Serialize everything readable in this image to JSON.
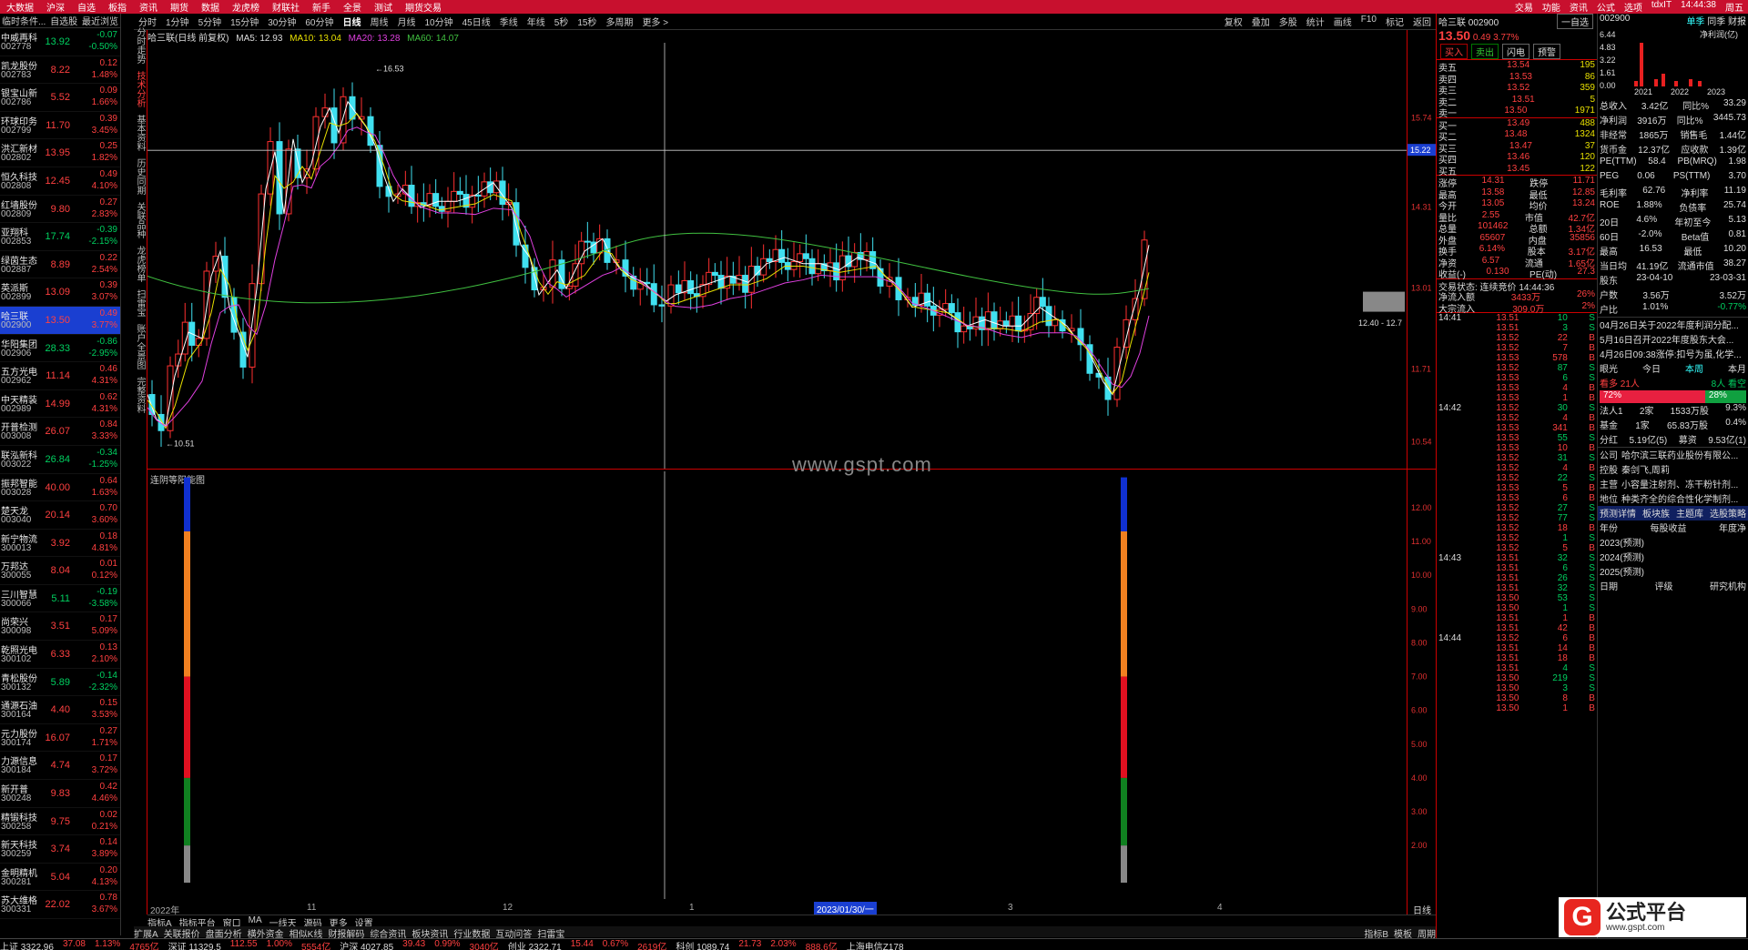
{
  "menubar": {
    "items": [
      "大数据",
      "沪深",
      "自选",
      "板指",
      "资讯",
      "期货",
      "数据",
      "龙虎榜",
      "财联社",
      "新手",
      "全景",
      "测试",
      "期货交易"
    ],
    "right": [
      "交易",
      "功能",
      "资讯",
      "公式",
      "选项",
      "tdxIT",
      "14:44:38",
      "周五"
    ]
  },
  "left_header": {
    "a": "临时条件...",
    "b": "自选股",
    "c": "最近浏览"
  },
  "stocks": [
    {
      "name": "中威再科",
      "code": "002778",
      "price": "13.92",
      "chg": "-0.07",
      "pct": "-0.50%",
      "d": "dn"
    },
    {
      "name": "凯龙股份",
      "code": "002783",
      "price": "8.22",
      "chg": "0.12",
      "pct": "1.48%",
      "d": "up"
    },
    {
      "name": "银宝山新",
      "code": "002786",
      "price": "5.52",
      "chg": "0.09",
      "pct": "1.66%",
      "d": "up"
    },
    {
      "name": "环球印务",
      "code": "002799",
      "price": "11.70",
      "chg": "0.39",
      "pct": "3.45%",
      "d": "up"
    },
    {
      "name": "洪汇新材",
      "code": "002802",
      "price": "13.95",
      "chg": "0.25",
      "pct": "1.82%",
      "d": "up"
    },
    {
      "name": "恒久科技",
      "code": "002808",
      "price": "12.45",
      "chg": "0.49",
      "pct": "4.10%",
      "d": "up"
    },
    {
      "name": "红墙股份",
      "code": "002809",
      "price": "9.80",
      "chg": "0.27",
      "pct": "2.83%",
      "d": "up"
    },
    {
      "name": "亚翔科",
      "code": "002853",
      "price": "17.74",
      "chg": "-0.39",
      "pct": "-2.15%",
      "d": "dn"
    },
    {
      "name": "绿茵生态",
      "code": "002887",
      "price": "8.89",
      "chg": "0.22",
      "pct": "2.54%",
      "d": "up"
    },
    {
      "name": "英派斯",
      "code": "002899",
      "price": "13.09",
      "chg": "0.39",
      "pct": "3.07%",
      "d": "up"
    },
    {
      "name": "哈三联",
      "code": "002900",
      "price": "13.50",
      "chg": "0.49",
      "pct": "3.77%",
      "d": "up",
      "sel": true
    },
    {
      "name": "华阳集团",
      "code": "002906",
      "price": "28.33",
      "chg": "-0.86",
      "pct": "-2.95%",
      "d": "dn"
    },
    {
      "name": "五方光电",
      "code": "002962",
      "price": "11.14",
      "chg": "0.46",
      "pct": "4.31%",
      "d": "up"
    },
    {
      "name": "中天精装",
      "code": "002989",
      "price": "14.99",
      "chg": "0.62",
      "pct": "4.31%",
      "d": "up"
    },
    {
      "name": "开普检测",
      "code": "003008",
      "price": "26.07",
      "chg": "0.84",
      "pct": "3.33%",
      "d": "up"
    },
    {
      "name": "联泓新科",
      "code": "003022",
      "price": "26.84",
      "chg": "-0.34",
      "pct": "-1.25%",
      "d": "dn"
    },
    {
      "name": "振邦智能",
      "code": "003028",
      "price": "40.00",
      "chg": "0.64",
      "pct": "1.63%",
      "d": "up"
    },
    {
      "name": "楚天龙",
      "code": "003040",
      "price": "20.14",
      "chg": "0.70",
      "pct": "3.60%",
      "d": "up"
    },
    {
      "name": "新宁物流",
      "code": "300013",
      "price": "3.92",
      "chg": "0.18",
      "pct": "4.81%",
      "d": "up"
    },
    {
      "name": "万邦达",
      "code": "300055",
      "price": "8.04",
      "chg": "0.01",
      "pct": "0.12%",
      "d": "up"
    },
    {
      "name": "三川智慧",
      "code": "300066",
      "price": "5.11",
      "chg": "-0.19",
      "pct": "-3.58%",
      "d": "dn"
    },
    {
      "name": "尚荣兴",
      "code": "300098",
      "price": "3.51",
      "chg": "0.17",
      "pct": "5.09%",
      "d": "up"
    },
    {
      "name": "乾照光电",
      "code": "300102",
      "price": "6.33",
      "chg": "0.13",
      "pct": "2.10%",
      "d": "up"
    },
    {
      "name": "青松股份",
      "code": "300132",
      "price": "5.89",
      "chg": "-0.14",
      "pct": "-2.32%",
      "d": "dn"
    },
    {
      "name": "通源石油",
      "code": "300164",
      "price": "4.40",
      "chg": "0.15",
      "pct": "3.53%",
      "d": "up"
    },
    {
      "name": "元力股份",
      "code": "300174",
      "price": "16.07",
      "chg": "0.27",
      "pct": "1.71%",
      "d": "up"
    },
    {
      "name": "力源信息",
      "code": "300184",
      "price": "4.74",
      "chg": "0.17",
      "pct": "3.72%",
      "d": "up"
    },
    {
      "name": "新开普",
      "code": "300248",
      "price": "9.83",
      "chg": "0.42",
      "pct": "4.46%",
      "d": "up"
    },
    {
      "name": "精锻科技",
      "code": "300258",
      "price": "9.75",
      "chg": "0.02",
      "pct": "0.21%",
      "d": "up"
    },
    {
      "name": "新天科技",
      "code": "300259",
      "price": "3.74",
      "chg": "0.14",
      "pct": "3.89%",
      "d": "up"
    },
    {
      "name": "金明精机",
      "code": "300281",
      "price": "5.04",
      "chg": "0.20",
      "pct": "4.13%",
      "d": "up"
    },
    {
      "name": "苏大维格",
      "code": "300331",
      "price": "22.02",
      "chg": "0.78",
      "pct": "3.67%",
      "d": "up"
    }
  ],
  "vtabs": [
    "分时走势",
    "技术分析",
    "基本资料",
    "历史同期",
    "关联品种",
    "龙虎榜单",
    "扫雷宝",
    "账户全景图",
    "完整资料"
  ],
  "toptabs": [
    "分时",
    "1分钟",
    "5分钟",
    "15分钟",
    "30分钟",
    "60分钟",
    "日线",
    "周线",
    "月线",
    "10分钟",
    "45日线",
    "季线",
    "年线",
    "5秒",
    "15秒",
    "多周期",
    "更多 >"
  ],
  "toptabs_right": [
    "复权",
    "叠加",
    "多股",
    "统计",
    "画线",
    "F10",
    "标记",
    "返回"
  ],
  "chart_info": {
    "name": "哈三联(日线 前复权)",
    "ma5": "MA5: 12.93",
    "ma10": "MA10: 13.04",
    "ma20": "MA20: 13.28",
    "ma60": "MA60: 14.07"
  },
  "main_axis": [
    "15.74",
    "15.22",
    "14.31",
    "13.01",
    "11.71",
    "10.54"
  ],
  "high_label": "16.53",
  "low_label": "10.51",
  "crosshair_value": "15.22",
  "range_label": "12.40 - 12.7",
  "sub_title": "连阴等阳能图",
  "sub_axis": [
    "12.00",
    "11.00",
    "10.00",
    "9.00",
    "8.00",
    "7.00",
    "6.00",
    "5.00",
    "4.00",
    "3.00",
    "2.00"
  ],
  "x_dates": [
    "2022年",
    "11",
    "12",
    "1",
    "2023/01/30/一",
    "3",
    "4",
    "日线"
  ],
  "bottab1": [
    "指标A",
    "指标平台",
    "窗口",
    "MA",
    "一线天",
    "源码",
    "更多",
    "设置"
  ],
  "bottab2": [
    "扩展A",
    "关联报价",
    "盘面分析",
    "横外资金",
    "相似K线",
    "财报解码",
    "综合资讯",
    "板块资讯",
    "行业数据",
    "互动问答",
    "扫雷宝"
  ],
  "bottab2_right": [
    "指标B",
    "模板",
    "周期"
  ],
  "watermark": "www.gspt.com",
  "quote": {
    "name": "哈三联",
    "code": "002900",
    "tag": "一自选",
    "price": "13.50",
    "chg": "0.49",
    "pct": "3.77%",
    "btns": [
      "买入",
      "卖出",
      "闪电",
      "预警"
    ],
    "asks": [
      [
        "卖五",
        "13.54",
        "195"
      ],
      [
        "卖四",
        "13.53",
        "86"
      ],
      [
        "卖三",
        "13.52",
        "359"
      ],
      [
        "卖二",
        "13.51",
        "5"
      ],
      [
        "卖一",
        "13.50",
        "1971"
      ]
    ],
    "bids": [
      [
        "买一",
        "13.49",
        "488"
      ],
      [
        "买二",
        "13.48",
        "1324"
      ],
      [
        "买三",
        "13.47",
        "37"
      ],
      [
        "买四",
        "13.46",
        "120"
      ],
      [
        "买五",
        "13.45",
        "122"
      ]
    ],
    "stats": [
      [
        "涨停",
        "14.31",
        "跌停",
        "11.71"
      ],
      [
        "最高",
        "13.58",
        "最低",
        "12.85"
      ],
      [
        "今开",
        "13.05",
        "均价",
        "13.24"
      ],
      [
        "量比",
        "2.55",
        "市值",
        "42.7亿"
      ],
      [
        "总量",
        "101462",
        "总额",
        "1.34亿"
      ],
      [
        "外盘",
        "65607",
        "内盘",
        "35856"
      ],
      [
        "换手",
        "6.14%",
        "股本",
        "3.17亿"
      ],
      [
        "净资",
        "6.57",
        "流通",
        "1.65亿"
      ],
      [
        "收益(-)",
        "0.130",
        "PE(动)",
        "27.3"
      ]
    ],
    "trade_status": "交易状态: 连续竞价 14:44:36",
    "inflow": [
      [
        "净流入额",
        "3433万",
        "26%"
      ],
      [
        "大宗流入",
        "309.0万",
        "2%"
      ]
    ],
    "time_marks": [
      "14:41",
      "14:42",
      "14:43",
      "14:44"
    ],
    "ticks": [
      [
        "13.51",
        "10",
        "S"
      ],
      [
        "13.51",
        "3",
        "S"
      ],
      [
        "13.52",
        "22",
        "B"
      ],
      [
        "13.52",
        "7",
        "B"
      ],
      [
        "13.53",
        "578",
        "B"
      ],
      [
        "13.52",
        "87",
        "S"
      ],
      [
        "13.53",
        "6",
        "S"
      ],
      [
        "13.53",
        "4",
        "B"
      ],
      [
        "13.53",
        "1",
        "B"
      ],
      [
        "13.52",
        "30",
        "S"
      ],
      [
        "13.52",
        "4",
        "B"
      ],
      [
        "13.53",
        "341",
        "B"
      ],
      [
        "13.53",
        "55",
        "S"
      ],
      [
        "13.53",
        "10",
        "B"
      ],
      [
        "13.52",
        "31",
        "S"
      ],
      [
        "13.52",
        "4",
        "B"
      ],
      [
        "13.52",
        "22",
        "S"
      ],
      [
        "13.53",
        "5",
        "B"
      ],
      [
        "13.53",
        "6",
        "B"
      ],
      [
        "13.52",
        "27",
        "S"
      ],
      [
        "13.52",
        "77",
        "S"
      ],
      [
        "13.52",
        "18",
        "B"
      ],
      [
        "13.52",
        "1",
        "S"
      ],
      [
        "13.52",
        "5",
        "B"
      ],
      [
        "13.51",
        "32",
        "S"
      ],
      [
        "13.51",
        "6",
        "S"
      ],
      [
        "13.51",
        "26",
        "S"
      ],
      [
        "13.51",
        "32",
        "S"
      ],
      [
        "13.50",
        "53",
        "S"
      ],
      [
        "13.50",
        "1",
        "S"
      ],
      [
        "13.51",
        "1",
        "B"
      ],
      [
        "13.51",
        "42",
        "B"
      ],
      [
        "13.52",
        "6",
        "B"
      ],
      [
        "13.51",
        "14",
        "B"
      ],
      [
        "13.51",
        "18",
        "B"
      ],
      [
        "13.51",
        "4",
        "S"
      ],
      [
        "13.50",
        "219",
        "S"
      ],
      [
        "13.50",
        "3",
        "S"
      ],
      [
        "13.50",
        "8",
        "B"
      ],
      [
        "13.50",
        "1",
        "B"
      ]
    ]
  },
  "fund": {
    "code": "002900",
    "tabs": [
      "单季",
      "同季",
      "财报",
      "净利润(亿)"
    ],
    "bars": [
      "6.44",
      "4.83",
      "3.22",
      "1.61",
      "0.00"
    ],
    "years": [
      "2021",
      "2022",
      "2023"
    ],
    "rows": [
      [
        "总收入",
        "3.42亿",
        "同比%",
        "33.29"
      ],
      [
        "净利润",
        "3916万",
        "同比%",
        "3445.73"
      ],
      [
        "非经常",
        "1865万",
        "销售毛",
        "1.44亿"
      ],
      [
        "货币金",
        "12.37亿",
        "应收款",
        "1.39亿"
      ],
      [
        "PE(TTM)",
        "58.4",
        "PB(MRQ)",
        "1.98"
      ],
      [
        "PEG",
        "0.06",
        "PS(TTM)",
        "3.70"
      ],
      [
        "毛利率",
        "62.76",
        "净利率",
        "11.19"
      ],
      [
        "ROE",
        "1.88%",
        "负债率",
        "25.74"
      ],
      [
        "20日",
        "4.6%",
        "年初至今",
        "5.13"
      ],
      [
        "60日",
        "-2.0%",
        "Beta值",
        "0.81"
      ],
      [
        "最高",
        "16.53",
        "最低",
        "10.20"
      ],
      [
        "当日均",
        "41.19亿",
        "流通市值",
        "38.27"
      ],
      [
        "股东",
        "23-04-10",
        "",
        "23-03-31"
      ],
      [
        "户数",
        "3.56万",
        "",
        "3.52万"
      ],
      [
        "户比",
        "1.01%",
        "",
        "-0.77%"
      ]
    ],
    "news": [
      "04月26日关于2022年度利润分配...",
      "5月16日召开2022年度股东大会...",
      "4月26日09:38涨停:扣号为虽,化学..."
    ],
    "vote": {
      "label": "眼光",
      "today": "今日",
      "week": "本周",
      "month": "本月",
      "bull": "看多 21人",
      "bear": "8人 看空",
      "p1": "72%",
      "p2": "28%"
    },
    "holders": [
      [
        "法人1",
        "2家",
        "1533万股",
        "9.3%"
      ],
      [
        "基金",
        "1家",
        "65.83万股",
        "0.4%"
      ],
      [
        "分红",
        "5.19亿(5)",
        "募资",
        "9.53亿(1)"
      ]
    ],
    "company": [
      [
        "公司",
        "哈尔滨三联药业股份有限公..."
      ],
      [
        "控股",
        "秦剑飞,周莉"
      ],
      [
        "主营",
        "小容量注射剂、冻干粉针剂..."
      ],
      [
        "地位",
        "种类齐全的综合性化学制剂..."
      ]
    ],
    "ftabs": [
      "预测详情",
      "板块族",
      "主题库",
      "选股策略"
    ],
    "forecast_head": [
      "年份",
      "每股收益",
      "年度净"
    ],
    "forecast": [
      "2023(预测)",
      "2024(预测)",
      "2025(预测)"
    ],
    "rating_head": [
      "日期",
      "评级",
      "研究机构"
    ]
  },
  "statusbar": [
    "上证 3322.96",
    "37.08",
    "1.13%",
    "4765亿",
    "深证 11329.5",
    "112.55",
    "1.00%",
    "5554亿",
    "沪深 4027.85",
    "39.43",
    "0.99%",
    "3040亿",
    "创业 2322.71",
    "15.44",
    "0.67%",
    "2619亿",
    "科创 1089.74",
    "21.73",
    "2.03%",
    "888.6亿",
    "上海电信Z178"
  ],
  "logo": {
    "mark": "G",
    "name": "公式平台",
    "url": "www.gspt.com"
  },
  "colors": {
    "up": "#ff4040",
    "down": "#00d060",
    "ma5": "#ffffff",
    "ma10": "#e8e000",
    "ma20": "#e040e0",
    "ma60": "#40c040",
    "selected": "#1a3fd1",
    "frame": "#c00000"
  }
}
